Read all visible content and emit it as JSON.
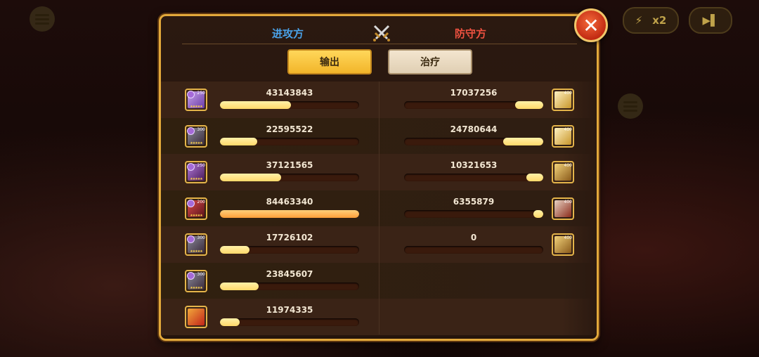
{
  "header": {
    "attacker_label": "进攻方",
    "defender_label": "防守方"
  },
  "tabs": [
    {
      "label": "输出",
      "active": true
    },
    {
      "label": "治疗",
      "active": false
    }
  ],
  "speed_label": "x2",
  "colors": {
    "attacker": "#4aa3ea",
    "defender": "#ee5140",
    "bar_fill": "#ffd86a",
    "bar_fill_max": "#ff9f3a",
    "bar_track": "#3a1a0c",
    "frame": "#e3a93b"
  },
  "attackers": [
    {
      "value": "43143843",
      "progress": 0.51,
      "level": "250",
      "stars": 5,
      "element": "dark",
      "portrait": "purple-mage"
    },
    {
      "value": "22595522",
      "progress": 0.27,
      "level": "300",
      "stars": 5,
      "element": "dark",
      "portrait": "dark-knight"
    },
    {
      "value": "37121565",
      "progress": 0.44,
      "level": "250",
      "stars": 5,
      "element": "dark",
      "portrait": "warlock"
    },
    {
      "value": "84463340",
      "progress": 1.0,
      "level": "200",
      "stars": 5,
      "element": "dark",
      "portrait": "red-dragon"
    },
    {
      "value": "17726102",
      "progress": 0.21,
      "level": "300",
      "stars": 5,
      "element": "dark",
      "portrait": "dark-knight"
    },
    {
      "value": "23845607",
      "progress": 0.28,
      "level": "300",
      "stars": 5,
      "element": "dark",
      "portrait": "dark-knight"
    },
    {
      "value": "11974335",
      "progress": 0.14,
      "level": "",
      "stars": 0,
      "element": "none",
      "portrait": "phoenix"
    }
  ],
  "defenders": [
    {
      "value": "17037256",
      "progress": 0.2,
      "level": "400",
      "portrait": "gold-angel"
    },
    {
      "value": "24780644",
      "progress": 0.29,
      "level": "400",
      "portrait": "gold-angel"
    },
    {
      "value": "10321653",
      "progress": 0.12,
      "level": "400",
      "portrait": "gold-paladin"
    },
    {
      "value": "6355879",
      "progress": 0.07,
      "level": "400",
      "portrait": "red-warrior"
    },
    {
      "value": "0",
      "progress": 0.0,
      "level": "400",
      "portrait": "gold-paladin"
    }
  ]
}
